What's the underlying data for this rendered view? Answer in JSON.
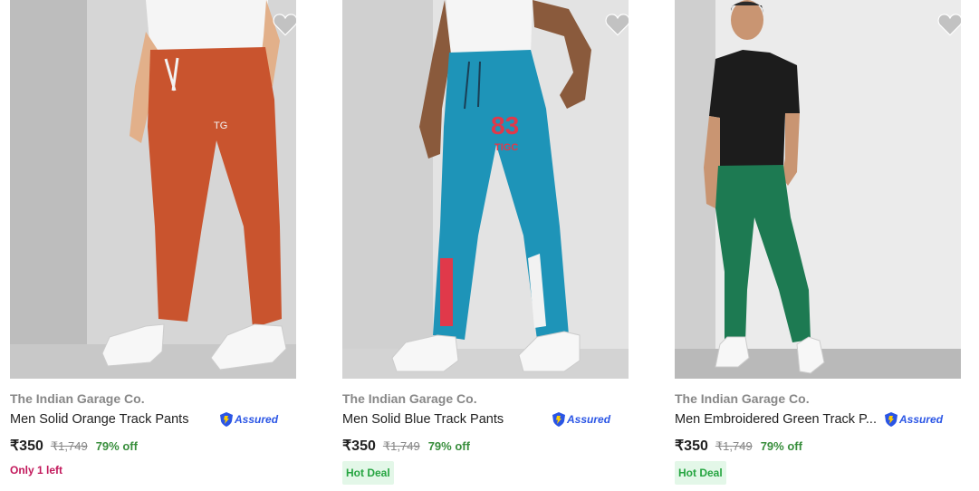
{
  "products": [
    {
      "brand": "The Indian Garage Co.",
      "title": "Men Solid Orange Track Pants",
      "price": "₹350",
      "mrp": "₹1,749",
      "discount": "79% off",
      "assured": "Assured",
      "tag": "Only 1 left",
      "pant_color": "#c9542e",
      "image_logo": "TG"
    },
    {
      "brand": "The Indian Garage Co.",
      "title": "Men Solid Blue Track Pants",
      "price": "₹350",
      "mrp": "₹1,749",
      "discount": "79% off",
      "assured": "Assured",
      "tag": "Hot Deal",
      "pant_color": "#1e94b8",
      "image_print_number": "83",
      "image_print_word": "TIGC"
    },
    {
      "brand": "The Indian Garage Co.",
      "title": "Men Embroidered Green Track P...",
      "price": "₹350",
      "mrp": "₹1,749",
      "discount": "79% off",
      "assured": "Assured",
      "tag": "Hot Deal",
      "pant_color": "#1d7a52"
    }
  ],
  "colors": {
    "discount_green": "#388e3c",
    "stock_pink": "#c2185b",
    "assured_blue": "#2a55e5",
    "muted_gray": "#878787"
  }
}
